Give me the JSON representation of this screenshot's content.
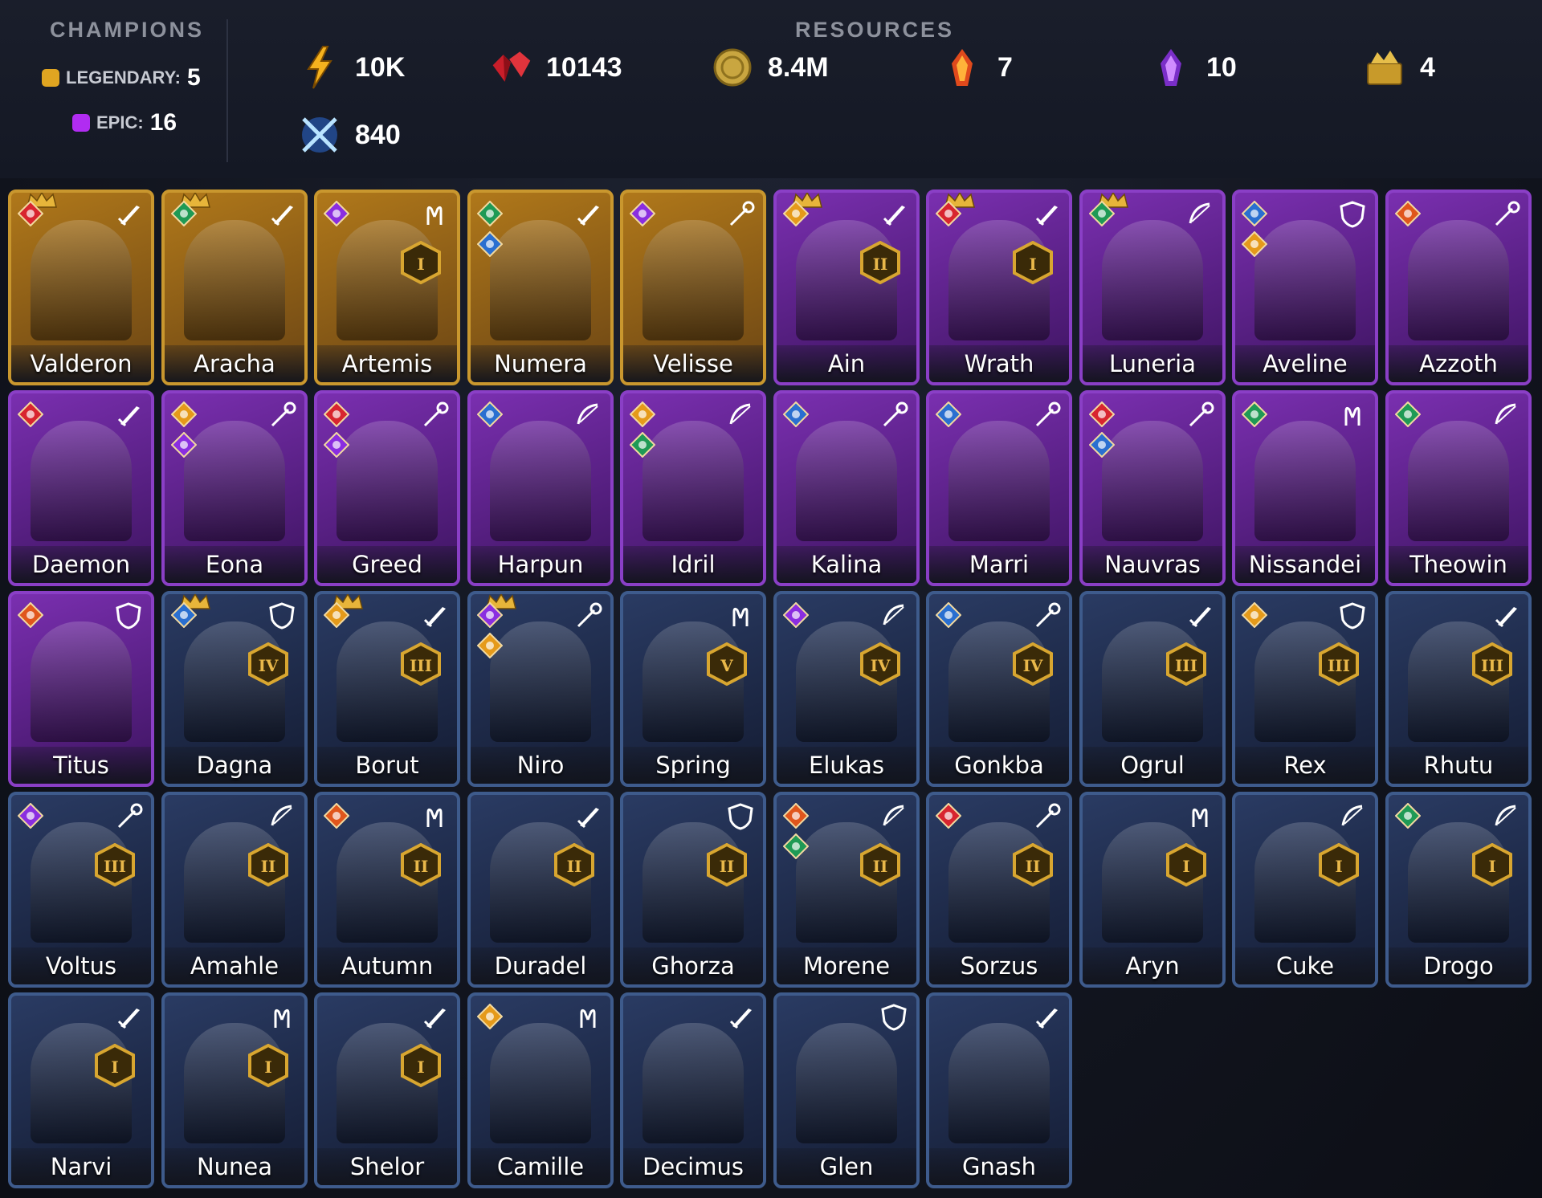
{
  "header": {
    "champions_title": "CHAMPIONS",
    "legendary_label": "LEGENDARY:",
    "legendary_count": "5",
    "epic_label": "EPIC:",
    "epic_count": "16",
    "resources_title": "RESOURCES",
    "resources": [
      {
        "icon": "energy-icon",
        "value": "10K"
      },
      {
        "icon": "ruby-icon",
        "value": "10143"
      },
      {
        "icon": "silver-coin-icon",
        "value": "8.4M"
      },
      {
        "icon": "fire-shard-icon",
        "value": "7"
      },
      {
        "icon": "void-shard-icon",
        "value": "10"
      },
      {
        "icon": "gold-chest-icon",
        "value": "4"
      },
      {
        "icon": "arena-token-icon",
        "value": "840"
      }
    ]
  },
  "colors": {
    "legendary": "#e0a521",
    "epic": "#b12cf2",
    "rare": "#3e5b8c"
  },
  "champions": [
    {
      "name": "Valderon",
      "rarity": "leg",
      "role": "sword-icon",
      "affinities": [
        "force-icon"
      ],
      "crown": true,
      "rank": ""
    },
    {
      "name": "Aracha",
      "rarity": "leg",
      "role": "sword-icon",
      "affinities": [
        "spirit-icon"
      ],
      "crown": true,
      "rank": ""
    },
    {
      "name": "Artemis",
      "rarity": "leg",
      "role": "hands-icon",
      "affinities": [
        "void-icon"
      ],
      "crown": false,
      "rank": "I"
    },
    {
      "name": "Numera",
      "rarity": "leg",
      "role": "sword-icon",
      "affinities": [
        "spirit-icon",
        "magic-icon"
      ],
      "crown": false,
      "rank": ""
    },
    {
      "name": "Velisse",
      "rarity": "leg",
      "role": "staff-icon",
      "affinities": [
        "void-icon"
      ],
      "crown": false,
      "rank": ""
    },
    {
      "name": "Ain",
      "rarity": "epic",
      "role": "sword-icon",
      "affinities": [
        "sun-icon"
      ],
      "crown": true,
      "rank": "II"
    },
    {
      "name": "Wrath",
      "rarity": "epic",
      "role": "sword-icon",
      "affinities": [
        "force-icon"
      ],
      "crown": true,
      "rank": "I"
    },
    {
      "name": "Luneria",
      "rarity": "epic",
      "role": "bow-icon",
      "affinities": [
        "spirit-icon"
      ],
      "crown": true,
      "rank": ""
    },
    {
      "name": "Aveline",
      "rarity": "epic",
      "role": "shield-icon",
      "affinities": [
        "magic-icon",
        "sun-icon"
      ],
      "crown": false,
      "rank": ""
    },
    {
      "name": "Azzoth",
      "rarity": "epic",
      "role": "staff-icon",
      "affinities": [
        "fire-icon"
      ],
      "crown": false,
      "rank": ""
    },
    {
      "name": "Daemon",
      "rarity": "epic",
      "role": "sword-icon",
      "affinities": [
        "force-icon"
      ],
      "crown": false,
      "rank": ""
    },
    {
      "name": "Eona",
      "rarity": "epic",
      "role": "staff-icon",
      "affinities": [
        "sun-icon",
        "void-icon"
      ],
      "crown": false,
      "rank": ""
    },
    {
      "name": "Greed",
      "rarity": "epic",
      "role": "staff-icon",
      "affinities": [
        "force-icon",
        "void-icon"
      ],
      "crown": false,
      "rank": ""
    },
    {
      "name": "Harpun",
      "rarity": "epic",
      "role": "bow-icon",
      "affinities": [
        "magic-icon"
      ],
      "crown": false,
      "rank": ""
    },
    {
      "name": "Idril",
      "rarity": "epic",
      "role": "bow-icon",
      "affinities": [
        "sun-icon",
        "spirit-icon"
      ],
      "crown": false,
      "rank": ""
    },
    {
      "name": "Kalina",
      "rarity": "epic",
      "role": "staff-icon",
      "affinities": [
        "magic-icon"
      ],
      "crown": false,
      "rank": ""
    },
    {
      "name": "Marri",
      "rarity": "epic",
      "role": "staff-icon",
      "affinities": [
        "magic-icon"
      ],
      "crown": false,
      "rank": ""
    },
    {
      "name": "Nauvras",
      "rarity": "epic",
      "role": "staff-icon",
      "affinities": [
        "force-icon",
        "magic-icon"
      ],
      "crown": false,
      "rank": ""
    },
    {
      "name": "Nissandei",
      "rarity": "epic",
      "role": "hands-icon",
      "affinities": [
        "spirit-icon"
      ],
      "crown": false,
      "rank": ""
    },
    {
      "name": "Theowin",
      "rarity": "epic",
      "role": "bow-icon",
      "affinities": [
        "spirit-icon"
      ],
      "crown": false,
      "rank": ""
    },
    {
      "name": "Titus",
      "rarity": "epic",
      "role": "shield-icon",
      "affinities": [
        "fire-icon"
      ],
      "crown": false,
      "rank": ""
    },
    {
      "name": "Dagna",
      "rarity": "rare",
      "role": "shield-icon",
      "affinities": [
        "magic-icon"
      ],
      "crown": true,
      "rank": "IV"
    },
    {
      "name": "Borut",
      "rarity": "rare",
      "role": "sword-icon",
      "affinities": [
        "sun-icon"
      ],
      "crown": true,
      "rank": "III"
    },
    {
      "name": "Niro",
      "rarity": "rare",
      "role": "staff-icon",
      "affinities": [
        "void-icon",
        "sun-icon"
      ],
      "crown": true,
      "rank": ""
    },
    {
      "name": "Spring",
      "rarity": "rare",
      "role": "hands-icon",
      "affinities": [],
      "crown": false,
      "rank": "V"
    },
    {
      "name": "Elukas",
      "rarity": "rare",
      "role": "bow-icon",
      "affinities": [
        "void-icon"
      ],
      "crown": false,
      "rank": "IV"
    },
    {
      "name": "Gonkba",
      "rarity": "rare",
      "role": "staff-icon",
      "affinities": [
        "magic-icon"
      ],
      "crown": false,
      "rank": "IV"
    },
    {
      "name": "Ogrul",
      "rarity": "rare",
      "role": "sword-icon",
      "affinities": [],
      "crown": false,
      "rank": "III"
    },
    {
      "name": "Rex",
      "rarity": "rare",
      "role": "shield-icon",
      "affinities": [
        "sun-icon"
      ],
      "crown": false,
      "rank": "III"
    },
    {
      "name": "Rhutu",
      "rarity": "rare",
      "role": "sword-icon",
      "affinities": [],
      "crown": false,
      "rank": "III"
    },
    {
      "name": "Voltus",
      "rarity": "rare",
      "role": "staff-icon",
      "affinities": [
        "void-icon"
      ],
      "crown": false,
      "rank": "III"
    },
    {
      "name": "Amahle",
      "rarity": "rare",
      "role": "bow-icon",
      "affinities": [],
      "crown": false,
      "rank": "II"
    },
    {
      "name": "Autumn",
      "rarity": "rare",
      "role": "hands-icon",
      "affinities": [
        "fire-icon"
      ],
      "crown": false,
      "rank": "II"
    },
    {
      "name": "Duradel",
      "rarity": "rare",
      "role": "sword-icon",
      "affinities": [],
      "crown": false,
      "rank": "II"
    },
    {
      "name": "Ghorza",
      "rarity": "rare",
      "role": "shield-icon",
      "affinities": [],
      "crown": false,
      "rank": "II"
    },
    {
      "name": "Morene",
      "rarity": "rare",
      "role": "bow-icon",
      "affinities": [
        "fire-icon",
        "spirit-icon"
      ],
      "crown": false,
      "rank": "II"
    },
    {
      "name": "Sorzus",
      "rarity": "rare",
      "role": "staff-icon",
      "affinities": [
        "force-icon"
      ],
      "crown": false,
      "rank": "II"
    },
    {
      "name": "Aryn",
      "rarity": "rare",
      "role": "hands-icon",
      "affinities": [],
      "crown": false,
      "rank": "I"
    },
    {
      "name": "Cuke",
      "rarity": "rare",
      "role": "bow-icon",
      "affinities": [],
      "crown": false,
      "rank": "I"
    },
    {
      "name": "Drogo",
      "rarity": "rare",
      "role": "bow-icon",
      "affinities": [
        "spirit-icon"
      ],
      "crown": false,
      "rank": "I"
    },
    {
      "name": "Narvi",
      "rarity": "rare",
      "role": "sword-icon",
      "affinities": [],
      "crown": false,
      "rank": "I"
    },
    {
      "name": "Nunea",
      "rarity": "rare",
      "role": "hands-icon",
      "affinities": [],
      "crown": false,
      "rank": "I"
    },
    {
      "name": "Shelor",
      "rarity": "rare",
      "role": "sword-icon",
      "affinities": [],
      "crown": false,
      "rank": "I"
    },
    {
      "name": "Camille",
      "rarity": "rare",
      "role": "hands-icon",
      "affinities": [
        "sun-icon"
      ],
      "crown": false,
      "rank": ""
    },
    {
      "name": "Decimus",
      "rarity": "rare",
      "role": "sword-icon",
      "affinities": [],
      "crown": false,
      "rank": ""
    },
    {
      "name": "Glen",
      "rarity": "rare",
      "role": "shield-icon",
      "affinities": [],
      "crown": false,
      "rank": ""
    },
    {
      "name": "Gnash",
      "rarity": "rare",
      "role": "sword-icon",
      "affinities": [],
      "crown": false,
      "rank": ""
    }
  ]
}
